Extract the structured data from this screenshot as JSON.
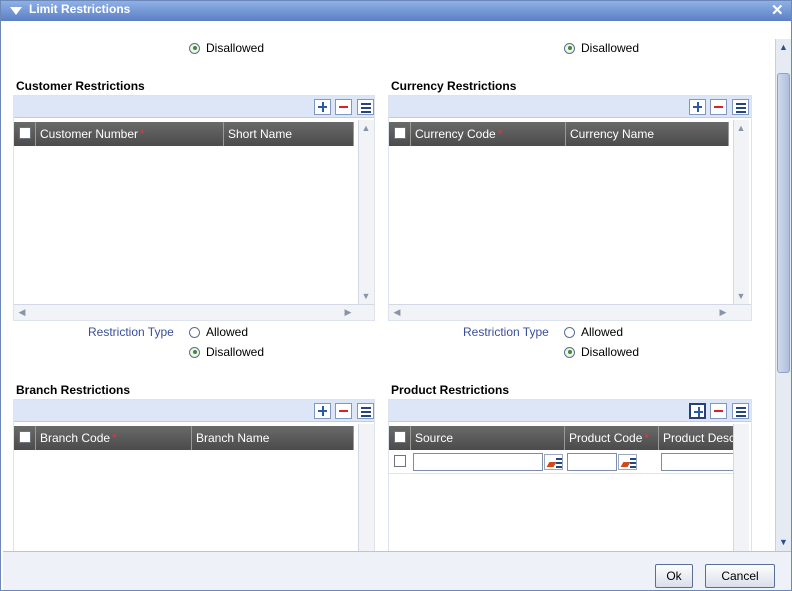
{
  "window": {
    "title": "Limit Restrictions"
  },
  "top_radios": {
    "left_label": "Disallowed",
    "right_label": "Disallowed"
  },
  "customer": {
    "title": "Customer Restrictions",
    "columns": [
      "Customer Number",
      "Short Name"
    ],
    "restriction_type_label": "Restriction Type",
    "allowed_label": "Allowed",
    "disallowed_label": "Disallowed",
    "selected": "Disallowed"
  },
  "currency": {
    "title": "Currency Restrictions",
    "columns": [
      "Currency Code",
      "Currency Name"
    ],
    "restriction_type_label": "Restriction Type",
    "allowed_label": "Allowed",
    "disallowed_label": "Disallowed",
    "selected": "Disallowed"
  },
  "branch": {
    "title": "Branch Restrictions",
    "columns": [
      "Branch Code",
      "Branch Name"
    ]
  },
  "product": {
    "title": "Product Restrictions",
    "columns": [
      "Source",
      "Product Code",
      "Product Desc"
    ],
    "row": {
      "source": "",
      "product_code": "",
      "product_desc": ""
    }
  },
  "required_marker": "*",
  "footer": {
    "ok_label": "Ok",
    "cancel_label": "Cancel"
  }
}
